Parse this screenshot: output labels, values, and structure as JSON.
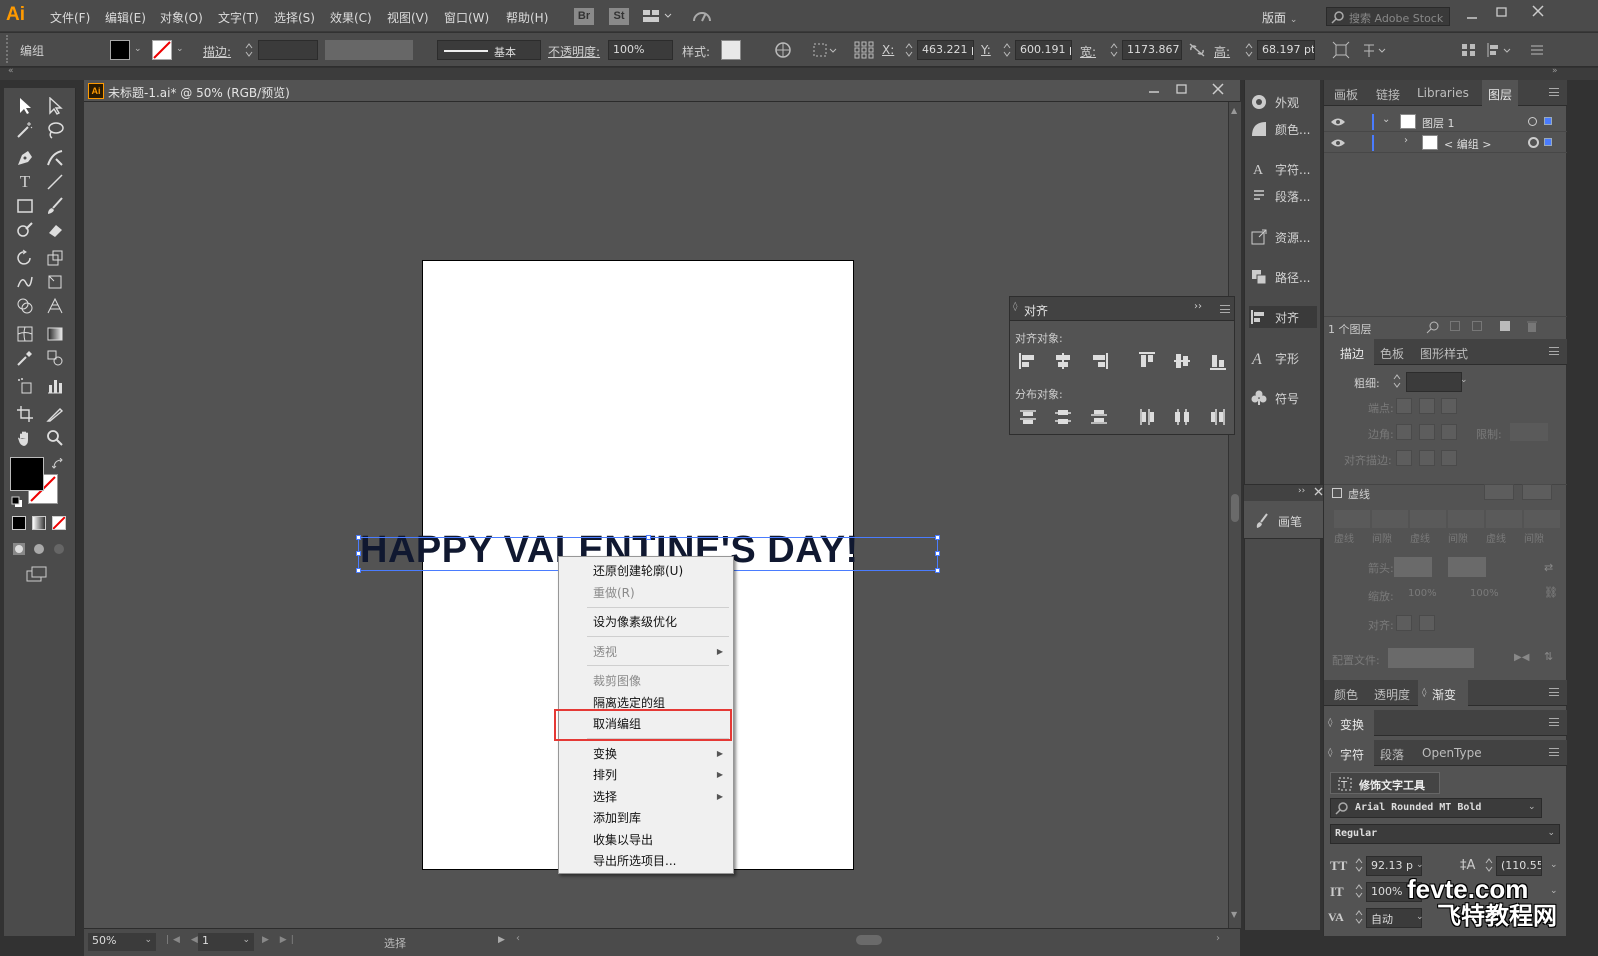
{
  "app": {
    "logo": "Ai",
    "menu": [
      "文件(F)",
      "编辑(E)",
      "对象(O)",
      "文字(T)",
      "选择(S)",
      "效果(C)",
      "视图(V)",
      "窗口(W)",
      "帮助(H)"
    ],
    "bridge_btn": "Br",
    "stock_btn": "St",
    "workspace": "版面",
    "search_placeholder": "搜索 Adobe Stock"
  },
  "control_bar": {
    "group_label": "编组",
    "stroke_label": "描边:",
    "stroke_profile": "基本",
    "opacity_label": "不透明度:",
    "opacity_value": "100%",
    "style_label": "样式:",
    "x_label": "X:",
    "x_value": "463.221 p",
    "y_label": "Y:",
    "y_value": "600.191 p",
    "w_label": "宽:",
    "w_value": "1173.867",
    "h_label": "高:",
    "h_value": "68.197 pt"
  },
  "document": {
    "tab_title": "未标题-1.ai* @ 50% (RGB/预览)",
    "headline": "HAPPY VALENTINE'S DAY!"
  },
  "context_menu": {
    "items": [
      {
        "label": "还原创建轮廓(U)",
        "enabled": true
      },
      {
        "label": "重做(R)",
        "enabled": false
      },
      {
        "label": "设为像素级优化",
        "enabled": true
      },
      {
        "label": "透视",
        "enabled": false
      },
      {
        "label": "裁剪图像",
        "enabled": false
      },
      {
        "label": "隔离选定的组",
        "enabled": true
      },
      {
        "label": "取消编组",
        "enabled": true,
        "highlighted": true
      },
      {
        "label": "变换",
        "enabled": true
      },
      {
        "label": "排列",
        "enabled": true
      },
      {
        "label": "选择",
        "enabled": true
      },
      {
        "label": "添加到库",
        "enabled": true
      },
      {
        "label": "收集以导出",
        "enabled": true
      },
      {
        "label": "导出所选项目...",
        "enabled": true
      }
    ]
  },
  "align_panel": {
    "title": "对齐",
    "align_objects": "对齐对象:",
    "distribute_objects": "分布对象:"
  },
  "dock": {
    "items": [
      "外观",
      "颜色...",
      "字符...",
      "段落...",
      "资源...",
      "路径...",
      "对齐",
      "字形",
      "符号"
    ],
    "brush": "画笔"
  },
  "layers_panel": {
    "tabs": [
      "画板",
      "链接",
      "Libraries",
      "图层"
    ],
    "layer_name": "图层 1",
    "sublayer_name": "< 编组 >",
    "count": "1 个图层"
  },
  "stroke_panel": {
    "tabs": [
      "描边",
      "色板",
      "图形样式"
    ],
    "weight": "粗细:",
    "cap": "端点:",
    "corner": "边角:",
    "limit": "限制:",
    "align_stroke": "对齐描边:",
    "dashed": "虚线",
    "dash_labels": [
      "虚线",
      "间隙",
      "虚线",
      "间隙",
      "虚线",
      "间隙"
    ],
    "arrow": "箭头:",
    "scale": "缩放:",
    "scale_value": "100%",
    "align": "对齐:",
    "profile": "配置文件:"
  },
  "color_row": {
    "tabs": [
      "颜色",
      "透明度",
      "渐变"
    ]
  },
  "transform_row": {
    "tab": "变换"
  },
  "char_panel": {
    "tabs": [
      "字符",
      "段落",
      "OpenType"
    ],
    "touch_tool": "修饰文字工具",
    "font": "Arial Rounded MT Bold",
    "style": "Regular",
    "size": "92.13 p",
    "leading": "(110.55",
    "hscale": "100%",
    "tracking": "自动"
  },
  "status": {
    "zoom": "50%",
    "artboard": "1",
    "tool": "选择"
  },
  "watermark": {
    "site": "fevte.com",
    "name": "飞特教程网"
  },
  "colors": {
    "accent": "#ff9a00",
    "selection": "#4a7cff",
    "highlight": "#e53935"
  }
}
